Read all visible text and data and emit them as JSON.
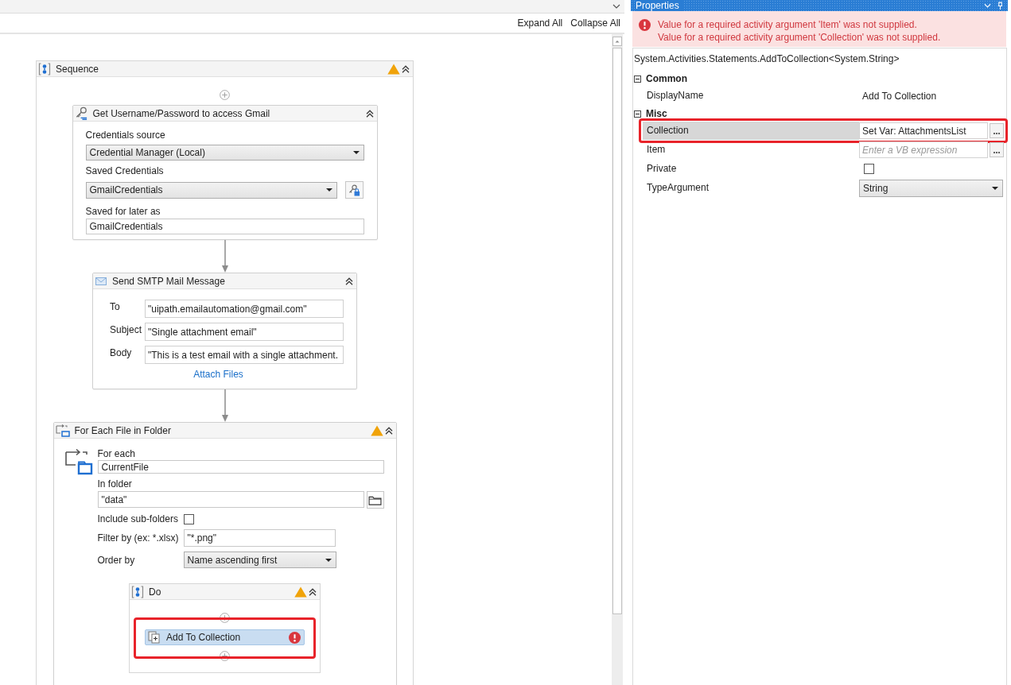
{
  "designer": {
    "toolbar_buttons": [
      "Expand All",
      "Collapse All"
    ],
    "sequence": {
      "title": "Sequence",
      "warning": true,
      "activities": [
        {
          "kind": "get_credentials",
          "title": "Get Username/Password to access Gmail",
          "warning": false,
          "credentials_source": {
            "label": "Credentials source",
            "value": "Credential Manager (Local)"
          },
          "saved_credentials": {
            "label": "Saved Credentials",
            "value": "GmailCredentials"
          },
          "saved_for_later_as": {
            "label": "Saved for later as",
            "value": "GmailCredentials"
          }
        },
        {
          "kind": "send_smtp_mail",
          "title": "Send SMTP Mail Message",
          "warning": false,
          "fields": [
            {
              "label": "To",
              "value": "\"uipath.emailautomation@gmail.com\""
            },
            {
              "label": "Subject",
              "value": "\"Single attachment email\""
            },
            {
              "label": "Body",
              "value": "\"This is a test email with a single attachment."
            }
          ],
          "link": "Attach Files"
        },
        {
          "kind": "for_each_file",
          "title": "For Each File in Folder",
          "warning": true,
          "for_each": {
            "label": "For each",
            "value": "CurrentFile"
          },
          "in_folder": {
            "label": "In folder",
            "value": "\"data\""
          },
          "include_subfolders": {
            "label": "Include sub-folders",
            "checked": false
          },
          "filter_by": {
            "label": "Filter by (ex: *.xlsx)",
            "value": "\"*.png\""
          },
          "order_by": {
            "label": "Order by",
            "value": "Name ascending first"
          },
          "body": {
            "title": "Do",
            "warning": true,
            "activities": [
              {
                "title": "Add To Collection",
                "error": true,
                "selected": true,
                "highlighted": true
              }
            ]
          }
        }
      ]
    }
  },
  "properties": {
    "title": "Properties",
    "errors": [
      "Value for a required activity argument 'Item' was not supplied.",
      "Value for a required activity argument 'Collection' was not supplied."
    ],
    "type_name": "System.Activities.Statements.AddToCollection<System.String>",
    "categories": [
      {
        "name": "Common",
        "expanded": true,
        "rows": [
          {
            "name": "DisplayName",
            "kind": "text",
            "value": "Add To Collection",
            "selected": false,
            "highlighted": false
          }
        ]
      },
      {
        "name": "Misc",
        "expanded": true,
        "rows": [
          {
            "name": "Collection",
            "kind": "expression",
            "value": "Set Var: AttachmentsList",
            "selected": true,
            "highlighted": true
          },
          {
            "name": "Item",
            "kind": "expression",
            "placeholder": "Enter a VB expression",
            "selected": false,
            "highlighted": false
          },
          {
            "name": "Private",
            "kind": "checkbox",
            "checked": false,
            "selected": false,
            "highlighted": false
          },
          {
            "name": "TypeArgument",
            "kind": "dropdown",
            "value": "String",
            "selected": false,
            "highlighted": false
          }
        ]
      }
    ]
  }
}
